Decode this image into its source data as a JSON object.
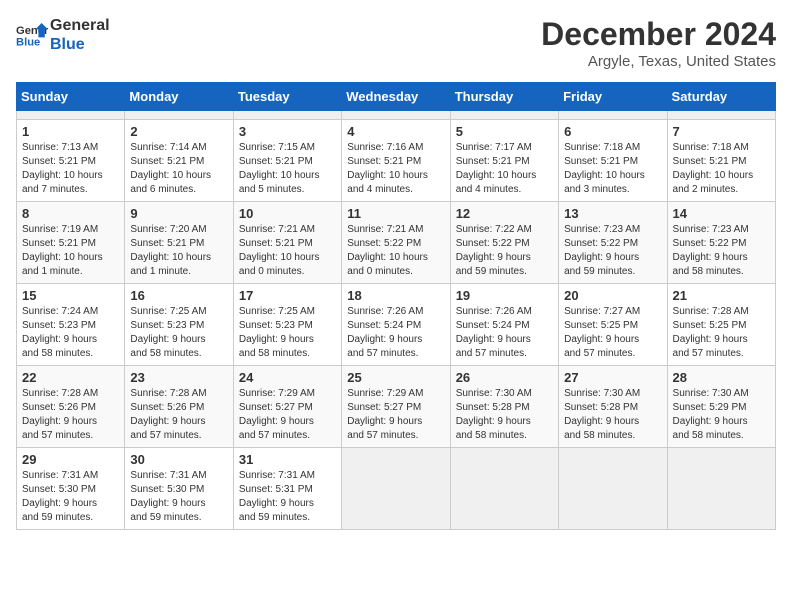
{
  "header": {
    "logo_line1": "General",
    "logo_line2": "Blue",
    "month_title": "December 2024",
    "location": "Argyle, Texas, United States"
  },
  "calendar": {
    "days_of_week": [
      "Sunday",
      "Monday",
      "Tuesday",
      "Wednesday",
      "Thursday",
      "Friday",
      "Saturday"
    ],
    "weeks": [
      [
        {
          "day": null,
          "info": null
        },
        {
          "day": null,
          "info": null
        },
        {
          "day": null,
          "info": null
        },
        {
          "day": null,
          "info": null
        },
        {
          "day": null,
          "info": null
        },
        {
          "day": null,
          "info": null
        },
        {
          "day": null,
          "info": null
        }
      ],
      [
        {
          "day": "1",
          "info": "Sunrise: 7:13 AM\nSunset: 5:21 PM\nDaylight: 10 hours\nand 7 minutes."
        },
        {
          "day": "2",
          "info": "Sunrise: 7:14 AM\nSunset: 5:21 PM\nDaylight: 10 hours\nand 6 minutes."
        },
        {
          "day": "3",
          "info": "Sunrise: 7:15 AM\nSunset: 5:21 PM\nDaylight: 10 hours\nand 5 minutes."
        },
        {
          "day": "4",
          "info": "Sunrise: 7:16 AM\nSunset: 5:21 PM\nDaylight: 10 hours\nand 4 minutes."
        },
        {
          "day": "5",
          "info": "Sunrise: 7:17 AM\nSunset: 5:21 PM\nDaylight: 10 hours\nand 4 minutes."
        },
        {
          "day": "6",
          "info": "Sunrise: 7:18 AM\nSunset: 5:21 PM\nDaylight: 10 hours\nand 3 minutes."
        },
        {
          "day": "7",
          "info": "Sunrise: 7:18 AM\nSunset: 5:21 PM\nDaylight: 10 hours\nand 2 minutes."
        }
      ],
      [
        {
          "day": "8",
          "info": "Sunrise: 7:19 AM\nSunset: 5:21 PM\nDaylight: 10 hours\nand 1 minute."
        },
        {
          "day": "9",
          "info": "Sunrise: 7:20 AM\nSunset: 5:21 PM\nDaylight: 10 hours\nand 1 minute."
        },
        {
          "day": "10",
          "info": "Sunrise: 7:21 AM\nSunset: 5:21 PM\nDaylight: 10 hours\nand 0 minutes."
        },
        {
          "day": "11",
          "info": "Sunrise: 7:21 AM\nSunset: 5:22 PM\nDaylight: 10 hours\nand 0 minutes."
        },
        {
          "day": "12",
          "info": "Sunrise: 7:22 AM\nSunset: 5:22 PM\nDaylight: 9 hours\nand 59 minutes."
        },
        {
          "day": "13",
          "info": "Sunrise: 7:23 AM\nSunset: 5:22 PM\nDaylight: 9 hours\nand 59 minutes."
        },
        {
          "day": "14",
          "info": "Sunrise: 7:23 AM\nSunset: 5:22 PM\nDaylight: 9 hours\nand 58 minutes."
        }
      ],
      [
        {
          "day": "15",
          "info": "Sunrise: 7:24 AM\nSunset: 5:23 PM\nDaylight: 9 hours\nand 58 minutes."
        },
        {
          "day": "16",
          "info": "Sunrise: 7:25 AM\nSunset: 5:23 PM\nDaylight: 9 hours\nand 58 minutes."
        },
        {
          "day": "17",
          "info": "Sunrise: 7:25 AM\nSunset: 5:23 PM\nDaylight: 9 hours\nand 58 minutes."
        },
        {
          "day": "18",
          "info": "Sunrise: 7:26 AM\nSunset: 5:24 PM\nDaylight: 9 hours\nand 57 minutes."
        },
        {
          "day": "19",
          "info": "Sunrise: 7:26 AM\nSunset: 5:24 PM\nDaylight: 9 hours\nand 57 minutes."
        },
        {
          "day": "20",
          "info": "Sunrise: 7:27 AM\nSunset: 5:25 PM\nDaylight: 9 hours\nand 57 minutes."
        },
        {
          "day": "21",
          "info": "Sunrise: 7:28 AM\nSunset: 5:25 PM\nDaylight: 9 hours\nand 57 minutes."
        }
      ],
      [
        {
          "day": "22",
          "info": "Sunrise: 7:28 AM\nSunset: 5:26 PM\nDaylight: 9 hours\nand 57 minutes."
        },
        {
          "day": "23",
          "info": "Sunrise: 7:28 AM\nSunset: 5:26 PM\nDaylight: 9 hours\nand 57 minutes."
        },
        {
          "day": "24",
          "info": "Sunrise: 7:29 AM\nSunset: 5:27 PM\nDaylight: 9 hours\nand 57 minutes."
        },
        {
          "day": "25",
          "info": "Sunrise: 7:29 AM\nSunset: 5:27 PM\nDaylight: 9 hours\nand 57 minutes."
        },
        {
          "day": "26",
          "info": "Sunrise: 7:30 AM\nSunset: 5:28 PM\nDaylight: 9 hours\nand 58 minutes."
        },
        {
          "day": "27",
          "info": "Sunrise: 7:30 AM\nSunset: 5:28 PM\nDaylight: 9 hours\nand 58 minutes."
        },
        {
          "day": "28",
          "info": "Sunrise: 7:30 AM\nSunset: 5:29 PM\nDaylight: 9 hours\nand 58 minutes."
        }
      ],
      [
        {
          "day": "29",
          "info": "Sunrise: 7:31 AM\nSunset: 5:30 PM\nDaylight: 9 hours\nand 59 minutes."
        },
        {
          "day": "30",
          "info": "Sunrise: 7:31 AM\nSunset: 5:30 PM\nDaylight: 9 hours\nand 59 minutes."
        },
        {
          "day": "31",
          "info": "Sunrise: 7:31 AM\nSunset: 5:31 PM\nDaylight: 9 hours\nand 59 minutes."
        },
        {
          "day": null,
          "info": null
        },
        {
          "day": null,
          "info": null
        },
        {
          "day": null,
          "info": null
        },
        {
          "day": null,
          "info": null
        }
      ]
    ]
  }
}
